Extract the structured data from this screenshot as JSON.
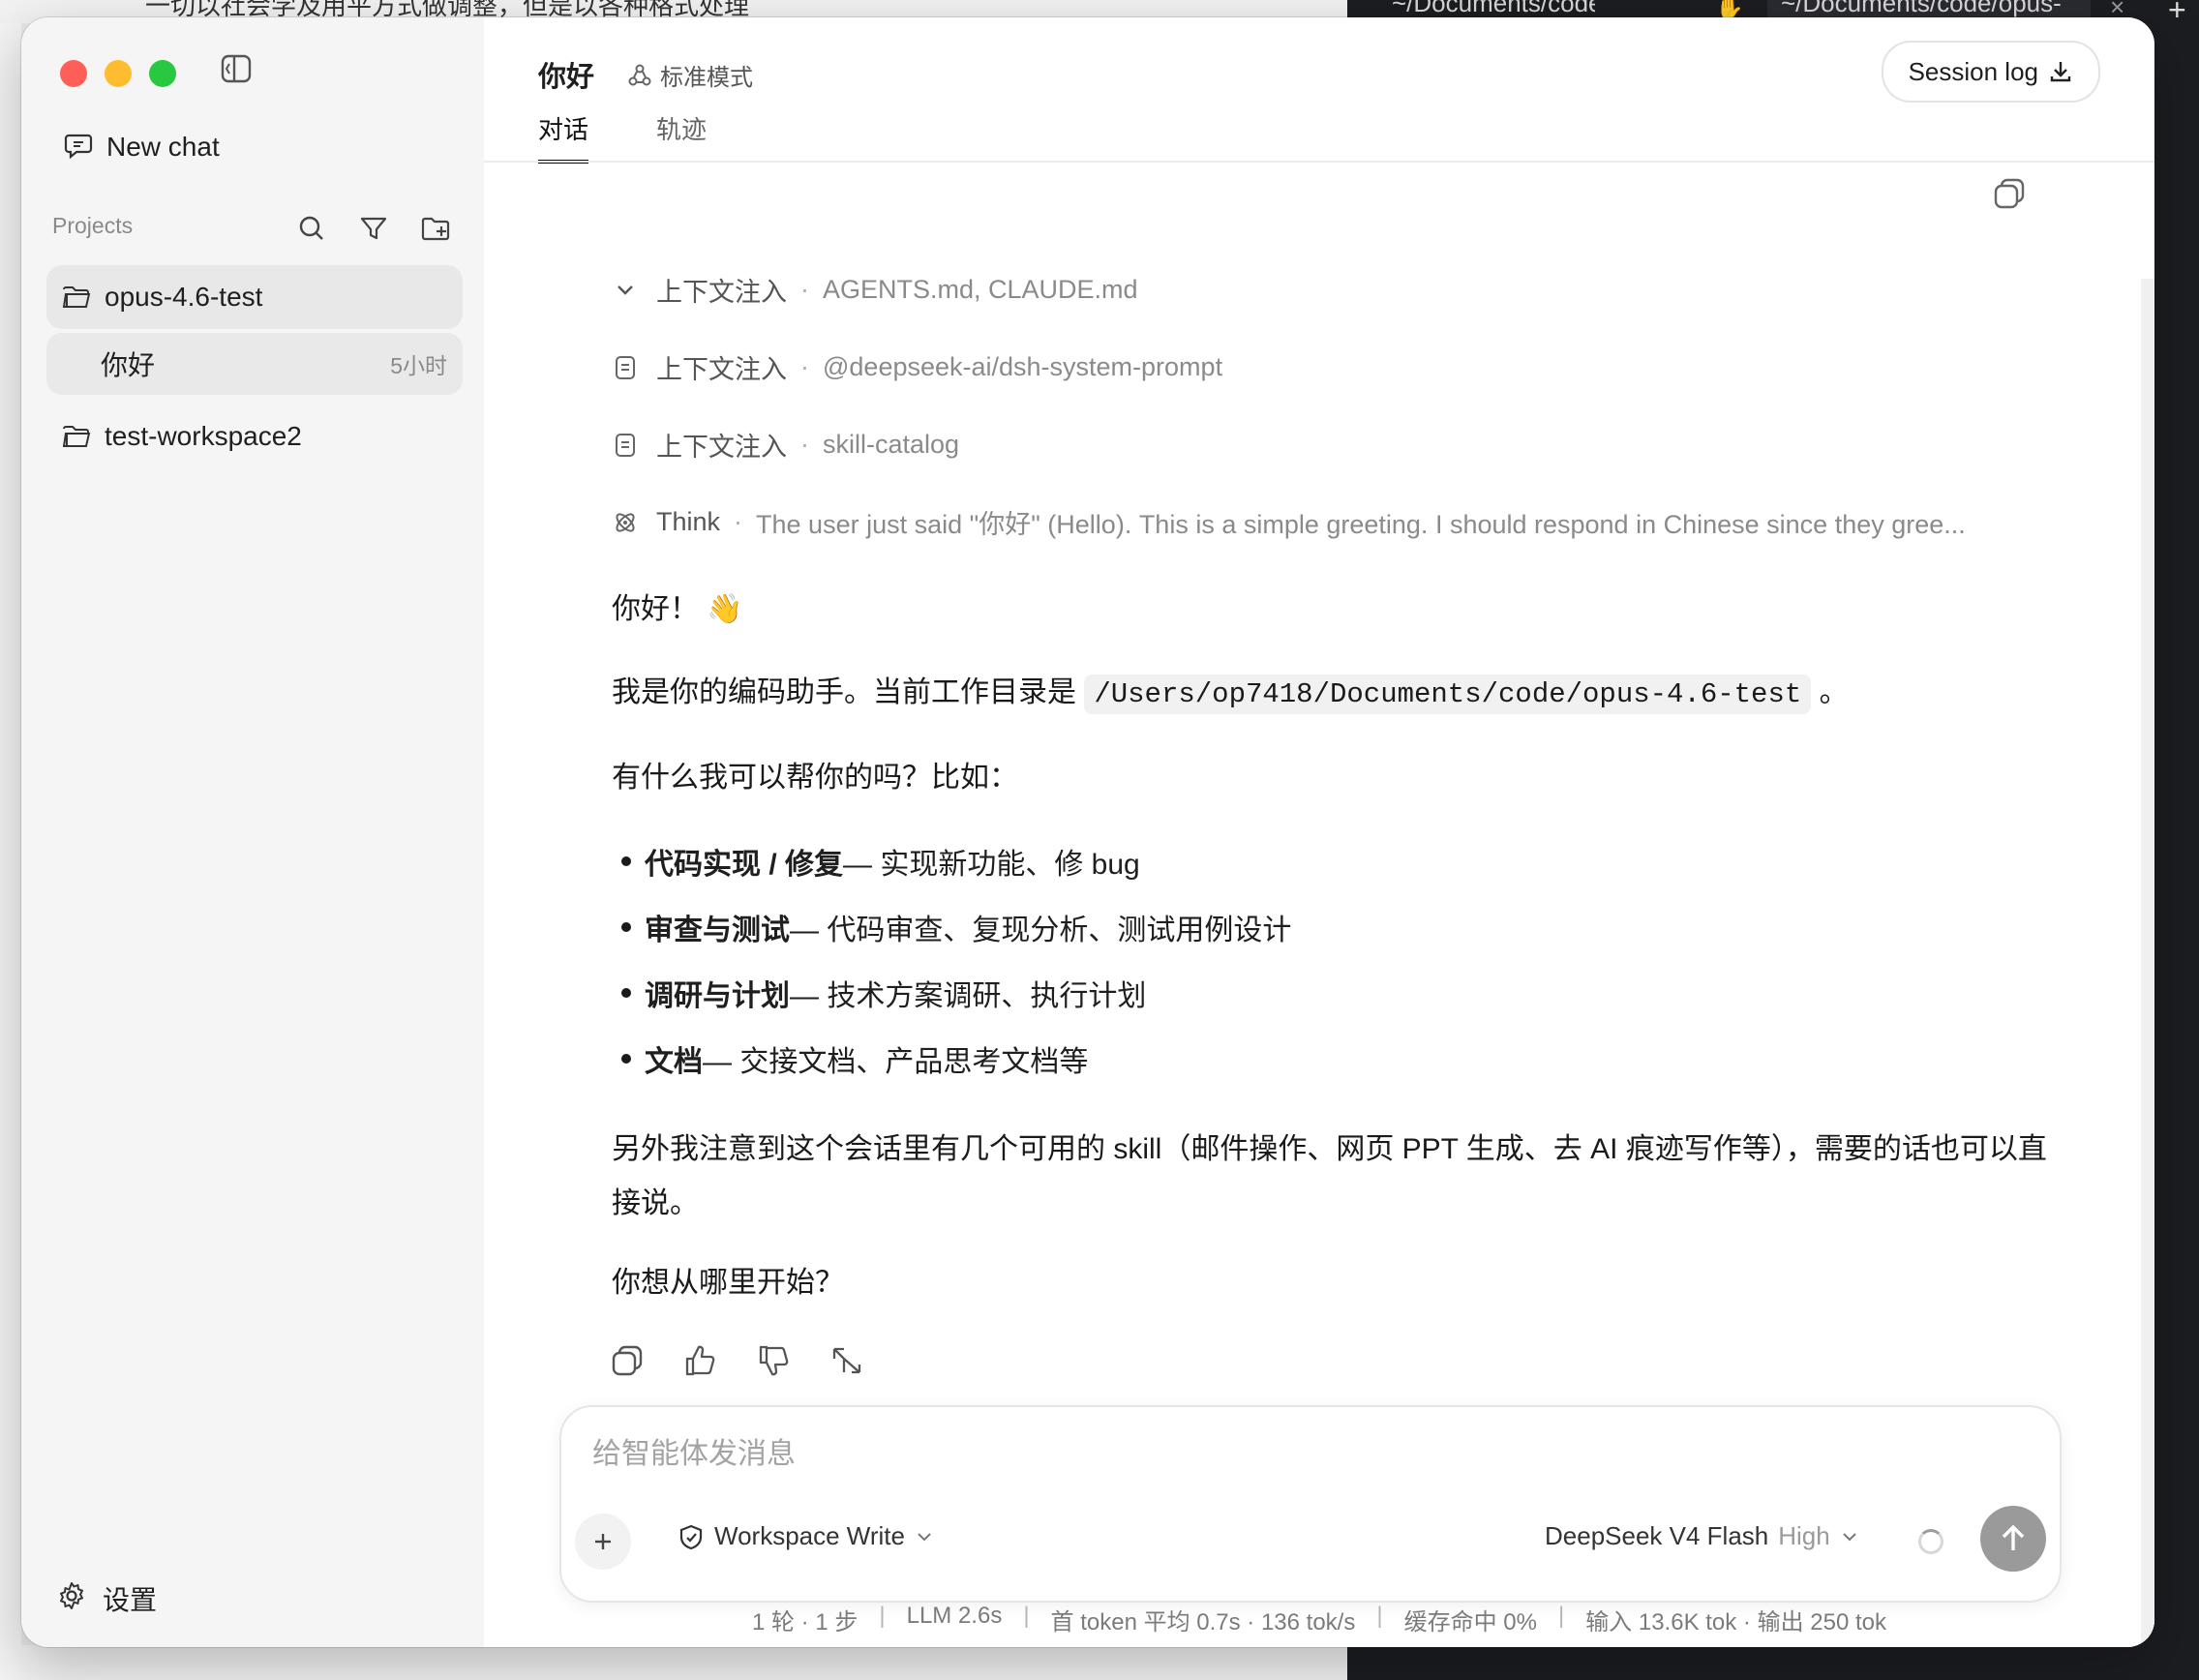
{
  "background": {
    "top_left_text": "一切以社会学及用平方式做调整，但是以各种格式处理",
    "terminal_tab_1": "~/Documents/code/op",
    "terminal_tab_2": "~/Documents/code/opus-"
  },
  "sidebar": {
    "new_chat_label": "New chat",
    "projects_label": "Projects",
    "projects": [
      {
        "name": "opus-4.6-test",
        "active": true
      },
      {
        "name": "test-workspace2",
        "active": false
      }
    ],
    "chats": [
      {
        "title": "你好",
        "time": "5小时"
      }
    ],
    "settings_label": "设置"
  },
  "header": {
    "title": "你好",
    "mode": "标准模式",
    "tabs": [
      {
        "label": "对话",
        "active": true
      },
      {
        "label": "轨迹",
        "active": false
      }
    ],
    "session_log_label": "Session log"
  },
  "conversation": {
    "context_rows": [
      {
        "name": "上下文注入",
        "detail": "AGENTS.md, CLAUDE.md",
        "icon": "chevron-down-icon"
      },
      {
        "name": "上下文注入",
        "detail": "@deepseek-ai/dsh-system-prompt",
        "icon": "document-icon"
      },
      {
        "name": "上下文注入",
        "detail": "skill-catalog",
        "icon": "document-icon"
      }
    ],
    "think": {
      "label": "Think",
      "detail": "The user just said \"你好\" (Hello). This is a simple greeting. I should respond in Chinese since they gree..."
    },
    "reply": {
      "greeting": "你好！",
      "greeting_emoji": "👋",
      "intro_before": "我是你的编码助手。当前工作目录是",
      "cwd": "/Users/op7418/Documents/code/opus-4.6-test",
      "intro_after": "。",
      "ask": "有什么我可以帮你的吗？比如：",
      "bullets": [
        {
          "bold": "代码实现 / 修复",
          "rest": " — 实现新功能、修 bug"
        },
        {
          "bold": "审查与测试",
          "rest": " — 代码审查、复现分析、测试用例设计"
        },
        {
          "bold": "调研与计划",
          "rest": " — 技术方案调研、执行计划"
        },
        {
          "bold": "文档",
          "rest": " — 交接文档、产品思考文档等"
        }
      ],
      "note": "另外我注意到这个会话里有几个可用的 skill（邮件操作、网页 PPT 生成、去 AI 痕迹写作等），需要的话也可以直接说。",
      "closing": "你想从哪里开始？"
    }
  },
  "composer": {
    "placeholder": "给智能体发消息",
    "permission_label": "Workspace Write",
    "model_name": "DeepSeek V4 Flash",
    "model_level": "High"
  },
  "stats": {
    "turns": "1 轮 · 1 步",
    "llm": "LLM 2.6s",
    "first_token": "首 token 平均 0.7s · 136 tok/s",
    "cache": "缓存命中 0%",
    "tokens": "输入 13.6K tok · 输出 250 tok"
  }
}
